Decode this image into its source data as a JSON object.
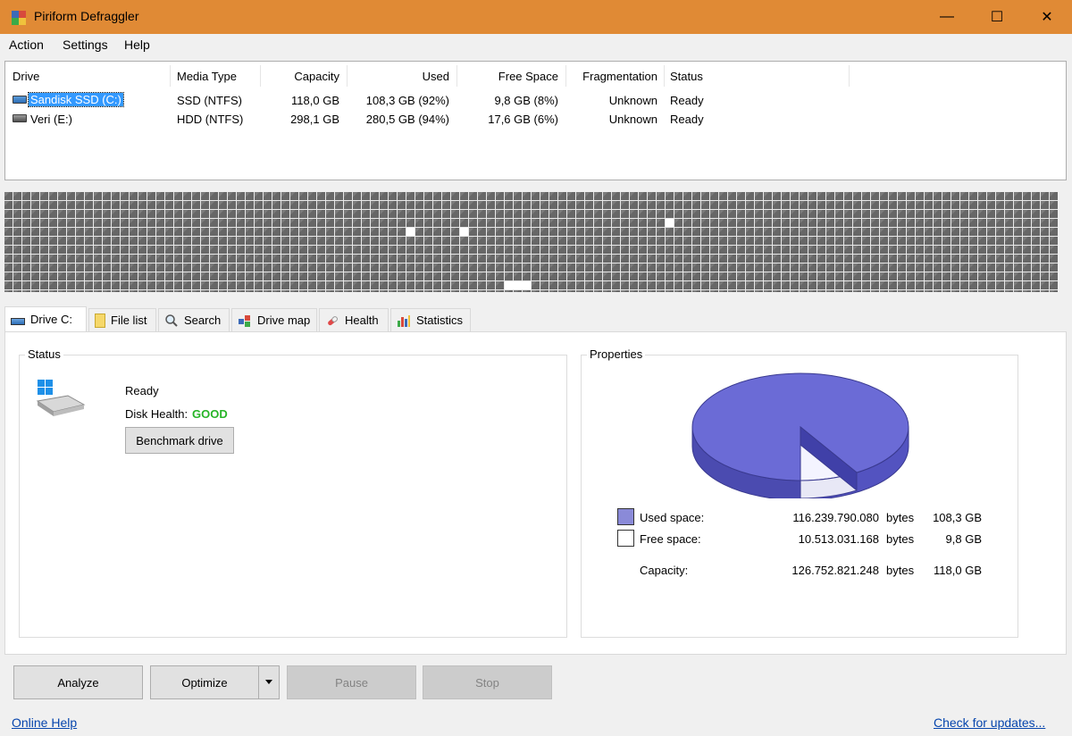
{
  "window": {
    "title": "Piriform Defraggler",
    "controls": {
      "minimize": "—",
      "maximize": "☐",
      "close": "✕"
    }
  },
  "menu": [
    "Action",
    "Settings",
    "Help"
  ],
  "drive_list": {
    "columns": [
      "Drive",
      "Media Type",
      "Capacity",
      "Used",
      "Free Space",
      "Fragmentation",
      "Status"
    ],
    "rows": [
      {
        "drive": "Sandisk SSD (C:)",
        "media": "SSD (NTFS)",
        "capacity": "118,0 GB",
        "used": "108,3 GB (92%)",
        "free": "9,8 GB (8%)",
        "fragmentation": "Unknown",
        "status": "Ready",
        "selected": true,
        "icon": "ssd-drive-icon"
      },
      {
        "drive": "Veri (E:)",
        "media": "HDD (NTFS)",
        "capacity": "298,1 GB",
        "used": "280,5 GB (94%)",
        "free": "17,6 GB (6%)",
        "fragmentation": "Unknown",
        "status": "Ready",
        "selected": false,
        "icon": "hdd-drive-icon"
      }
    ]
  },
  "tabs": [
    {
      "label": "Drive C:",
      "icon": "drive-icon",
      "active": true
    },
    {
      "label": "File list",
      "icon": "file-list-icon"
    },
    {
      "label": "Search",
      "icon": "search-icon"
    },
    {
      "label": "Drive map",
      "icon": "drive-map-icon"
    },
    {
      "label": "Health",
      "icon": "health-icon"
    },
    {
      "label": "Statistics",
      "icon": "statistics-icon"
    }
  ],
  "status_panel": {
    "legend": "Status",
    "state": "Ready",
    "health_label": "Disk Health:",
    "health_value": "GOOD",
    "benchmark_label": "Benchmark drive",
    "health_color": "#27b427"
  },
  "properties_panel": {
    "legend": "Properties",
    "used": {
      "label": "Used space:",
      "bytes": "116.239.790.080",
      "unit": "bytes",
      "size": "108,3 GB",
      "color": "#6b6bd6"
    },
    "free": {
      "label": "Free space:",
      "bytes": "10.513.031.168",
      "unit": "bytes",
      "size": "9,8 GB",
      "color": "#ffffff"
    },
    "capacity": {
      "label": "Capacity:",
      "bytes": "126.752.821.248",
      "unit": "bytes",
      "size": "118,0 GB"
    }
  },
  "buttons": {
    "analyze": "Analyze",
    "optimize": "Optimize",
    "pause": "Pause",
    "stop": "Stop"
  },
  "footer": {
    "online_help": "Online Help",
    "check_updates": "Check for updates..."
  }
}
